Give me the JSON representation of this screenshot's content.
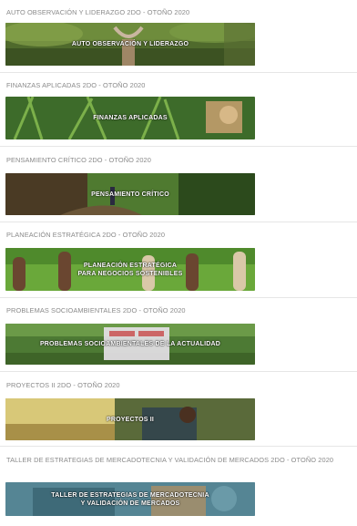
{
  "courses": [
    {
      "title": "AUTO OBSERVACIÓN Y LIDERAZGO 2do - Otoño 2020",
      "banner": "AUTO OBSERVACIÓN Y LIDERAZGO"
    },
    {
      "title": "FINANZAS APLICADAS 2do - Otoño 2020",
      "banner": "FINANZAS APLICADAS"
    },
    {
      "title": "PENSAMIENTO CRÍTICO 2do - Otoño 2020",
      "banner": "PENSAMIENTO CRÍTICO"
    },
    {
      "title": "PLANEACIÓN ESTRATÉGICA 2do - Otoño 2020",
      "banner": "PLANEACIÓN ESTRATÉGICA\nPARA NEGOCIOS SOSTENIBLES"
    },
    {
      "title": "PROBLEMAS SOCIOAMBIENTALES 2do - Otoño 2020",
      "banner": "PROBLEMAS SOCIOAMBIENTALES DE LA ACTUALIDAD"
    },
    {
      "title": "PROYECTOS II 2do - Otoño 2020",
      "banner": "PROYECTOS II"
    },
    {
      "title": "TALLER DE ESTRATEGIAS DE MERCADOTECNIA Y VALIDACIÓN DE MERCADOS 2do - Otoño 2020",
      "banner": "TALLER DE ESTRATEGIAS DE MERCADOTECNIA\nY VALIDACIÓN DE MERCADOS"
    }
  ]
}
